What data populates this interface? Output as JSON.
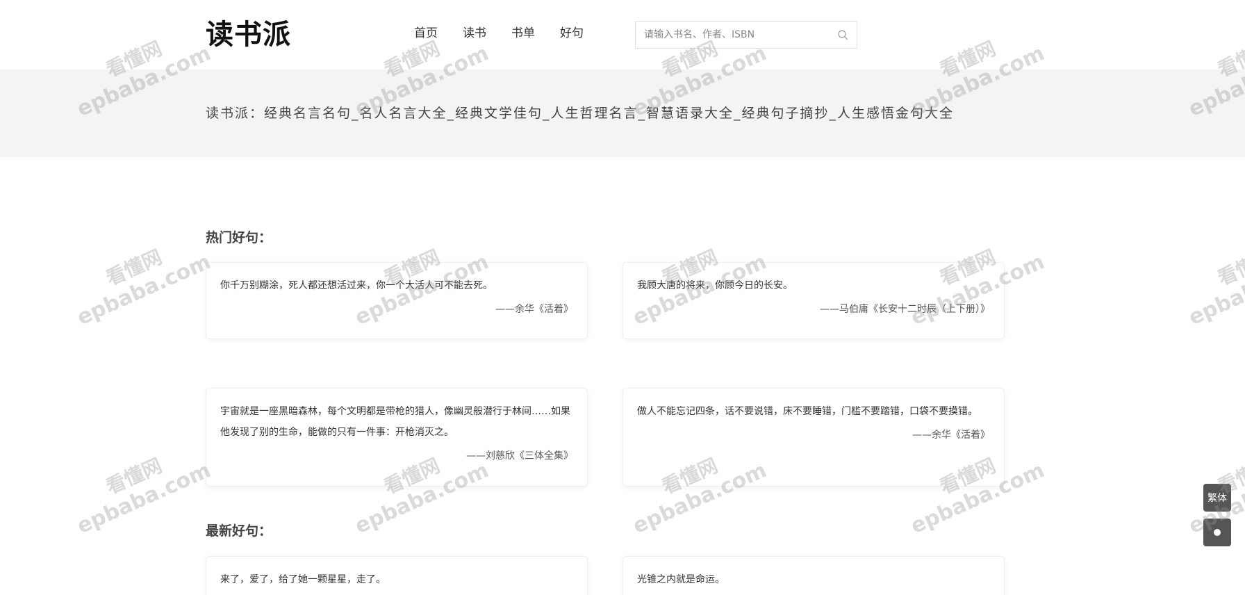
{
  "header": {
    "logo": "读书派",
    "nav": [
      "首页",
      "读书",
      "书单",
      "好句"
    ],
    "search_placeholder": "请输入书名、作者、ISBN"
  },
  "banner": {
    "title": "读书派：经典名言名句_名人名言大全_经典文学佳句_人生哲理名言_智慧语录大全_经典句子摘抄_人生感悟金句大全"
  },
  "hot": {
    "title": "热门好句：",
    "cards": [
      {
        "quote": "你千万别糊涂，死人都还想活过来，你一个大活人可不能去死。",
        "source": "——余华《活着》"
      },
      {
        "quote": "我顾大唐的将来，你顾今日的长安。",
        "source": "——马伯庸《长安十二时辰（上下册）》"
      },
      {
        "quote": "宇宙就是一座黑暗森林，每个文明都是带枪的猎人，像幽灵般潜行于林间……如果他发现了别的生命，能做的只有一件事：开枪消灭之。",
        "source": "——刘慈欣《三体全集》"
      },
      {
        "quote": "做人不能忘记四条，话不要说错，床不要睡错，门槛不要踏错，口袋不要摸错。",
        "source": "——余华《活着》"
      }
    ]
  },
  "latest": {
    "title": "最新好句：",
    "cards": [
      {
        "quote": "来了，爱了，给了她一颗星星，走了。"
      },
      {
        "quote": "光锥之内就是命运。"
      }
    ]
  },
  "side": {
    "traditional": "繁体"
  },
  "watermark": {
    "line1": "看懂网",
    "line2": "epbaba.com"
  }
}
